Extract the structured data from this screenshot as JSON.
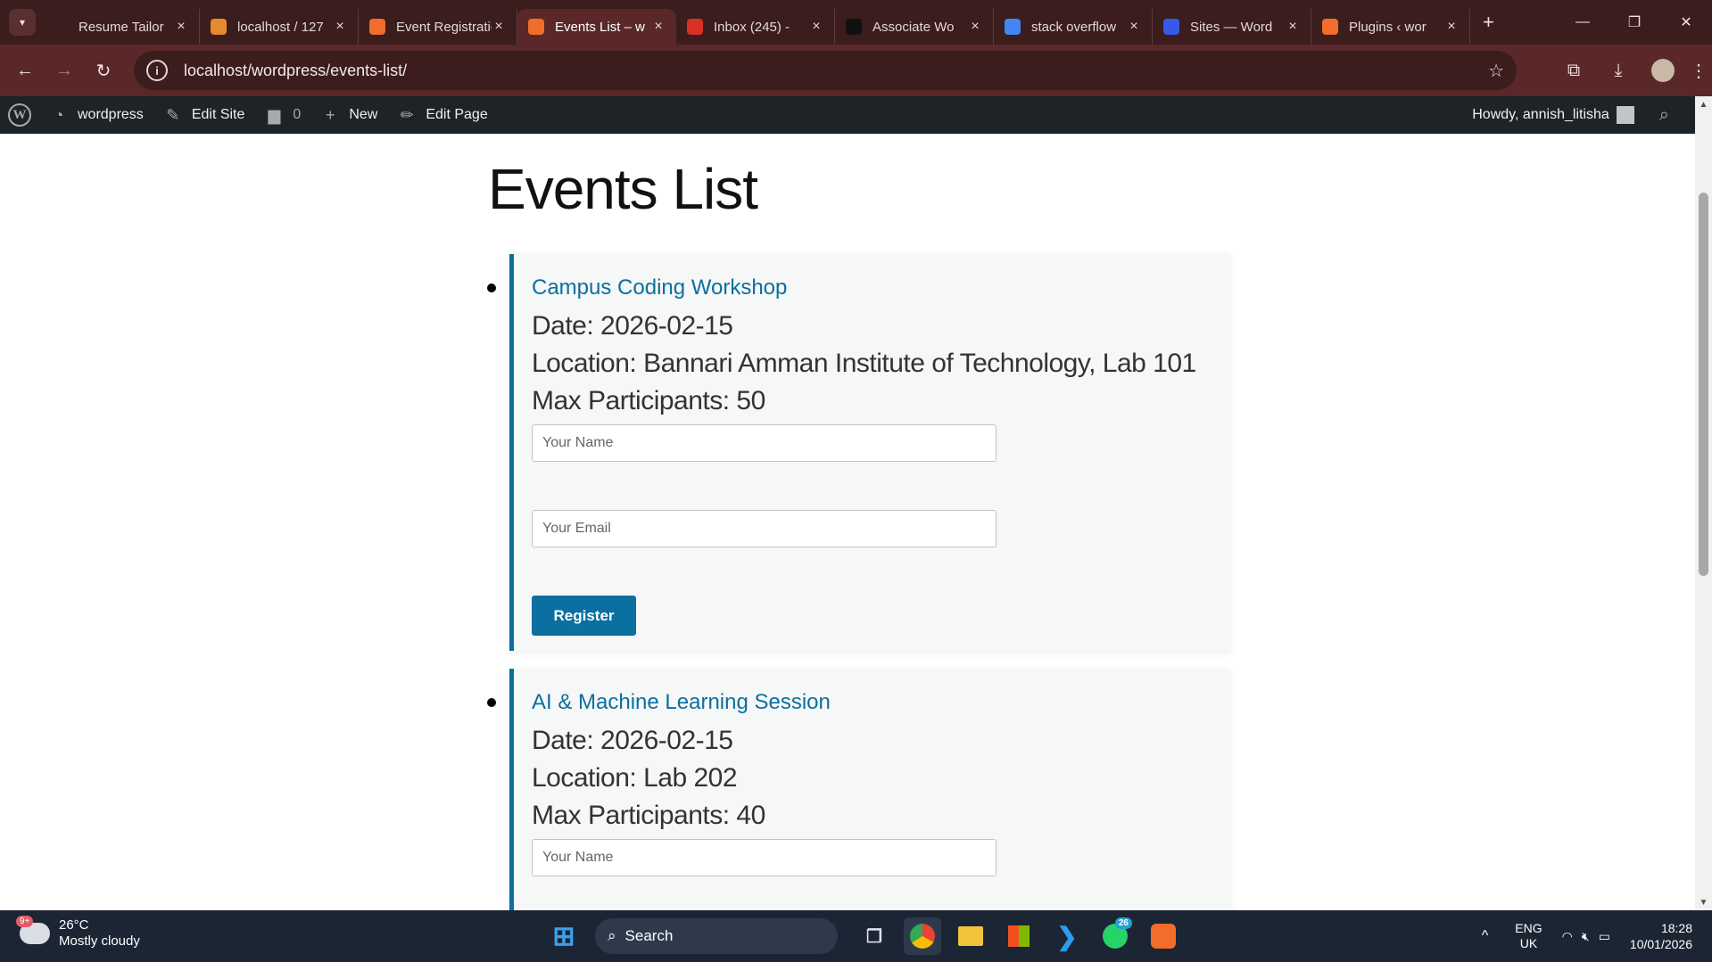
{
  "browser": {
    "tabs": [
      {
        "title": "Resume Tailor",
        "favicon": "openai-icon",
        "color": "#3b1d1d"
      },
      {
        "title": "localhost / 127",
        "favicon": "phpmyadmin-icon",
        "color": "#e68b2c"
      },
      {
        "title": "Event Registration",
        "favicon": "xampp-icon",
        "color": "#f26c2a"
      },
      {
        "title": "Events List – w",
        "favicon": "xampp-icon",
        "color": "#f26c2a",
        "active": true
      },
      {
        "title": "Inbox (245) -",
        "favicon": "gmail-icon",
        "color": "#d93025"
      },
      {
        "title": "Associate Wo",
        "favicon": "rt-icon",
        "color": "#111111"
      },
      {
        "title": "stack overflow",
        "favicon": "google-icon",
        "color": "#4285f4"
      },
      {
        "title": "Sites — Word",
        "favicon": "wordpress-icon",
        "color": "#3858e9"
      },
      {
        "title": "Plugins ‹ wor",
        "favicon": "xampp-icon",
        "color": "#f26c2a"
      }
    ],
    "url": "localhost/wordpress/events-list/"
  },
  "adminbar": {
    "site_name": "wordpress",
    "edit_site": "Edit Site",
    "comments_count": "0",
    "new_label": "New",
    "edit_page": "Edit Page",
    "howdy": "Howdy, annish_litisha"
  },
  "page": {
    "title": "Events List",
    "events": [
      {
        "title": "Campus Coding Workshop",
        "date": "Date: 2026-02-15",
        "location": "Location: Bannari Amman Institute of Technology, Lab 101",
        "max": "Max Participants: 50",
        "name_placeholder": "Your Name",
        "email_placeholder": "Your Email",
        "button": "Register"
      },
      {
        "title": "AI & Machine Learning Session",
        "date": "Date: 2026-02-15",
        "location": "Location: Lab 202",
        "max": "Max Participants: 40",
        "name_placeholder": "Your Name"
      }
    ]
  },
  "taskbar": {
    "weather_temp": "26°C",
    "weather_desc": "Mostly cloudy",
    "weather_badge": "9+",
    "search_label": "Search",
    "whatsapp_badge": "26",
    "lang_top": "ENG",
    "lang_bottom": "UK",
    "time": "18:28",
    "date": "10/01/2026"
  },
  "colors": {
    "accent": "#0b6fa0",
    "adminbar": "#1d2327",
    "chrome_frame": "#3b1d1d"
  }
}
